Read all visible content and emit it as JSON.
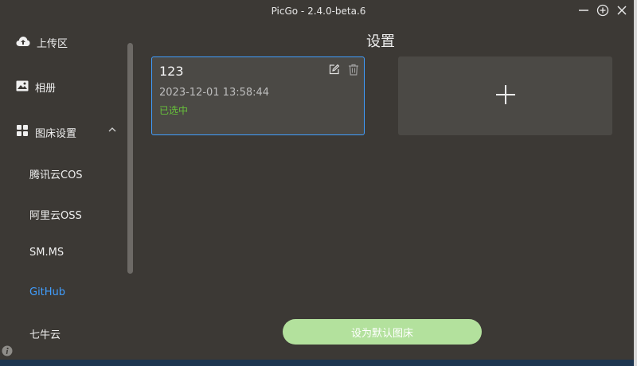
{
  "window": {
    "title": "PicGo - 2.4.0-beta.6"
  },
  "sidebar": {
    "upload_label": "上传区",
    "gallery_label": "相册",
    "settings_label": "图床设置",
    "subitems": [
      "腾讯云COS",
      "阿里云OSS",
      "SM.MS",
      "GitHub",
      "七牛云"
    ],
    "active_subitem": "GitHub"
  },
  "main": {
    "title": "设置",
    "config_card": {
      "name": "123",
      "time": "2023-12-01 13:58:44",
      "status": "已选中"
    },
    "default_button": "设为默认图床"
  },
  "colors": {
    "accent": "#409eff",
    "selected": "#67c23a",
    "button": "#b3e19d",
    "background": "#3c3935"
  }
}
